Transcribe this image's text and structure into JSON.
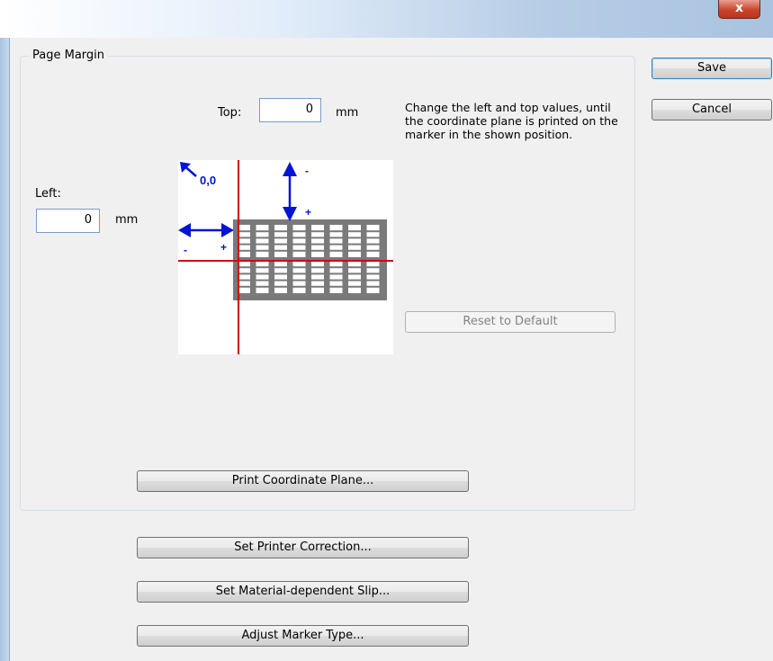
{
  "window": {
    "close_glyph": "x"
  },
  "page_margin": {
    "legend": "Page Margin",
    "top_label": "Top:",
    "top_value": "0",
    "top_unit": "mm",
    "left_label": "Left:",
    "left_value": "0",
    "left_unit": "mm",
    "description": "Change the left and top values, until the coordinate plane is printed on the marker in the shown position.",
    "diagram": {
      "origin_label": "0,0",
      "minus": "-",
      "plus": "+"
    },
    "reset_button": "Reset to Default",
    "print_button": "Print Coordinate Plane..."
  },
  "side_buttons": {
    "save": "Save",
    "cancel": "Cancel"
  },
  "bottom_buttons": {
    "printer_correction": "Set Printer Correction...",
    "material_slip": "Set Material-dependent Slip...",
    "marker_type": "Adjust Marker Type..."
  },
  "colors": {
    "axis_red": "#d4000f",
    "arrow_blue": "#0014d6",
    "marker_gray": "#7a7a7a"
  }
}
